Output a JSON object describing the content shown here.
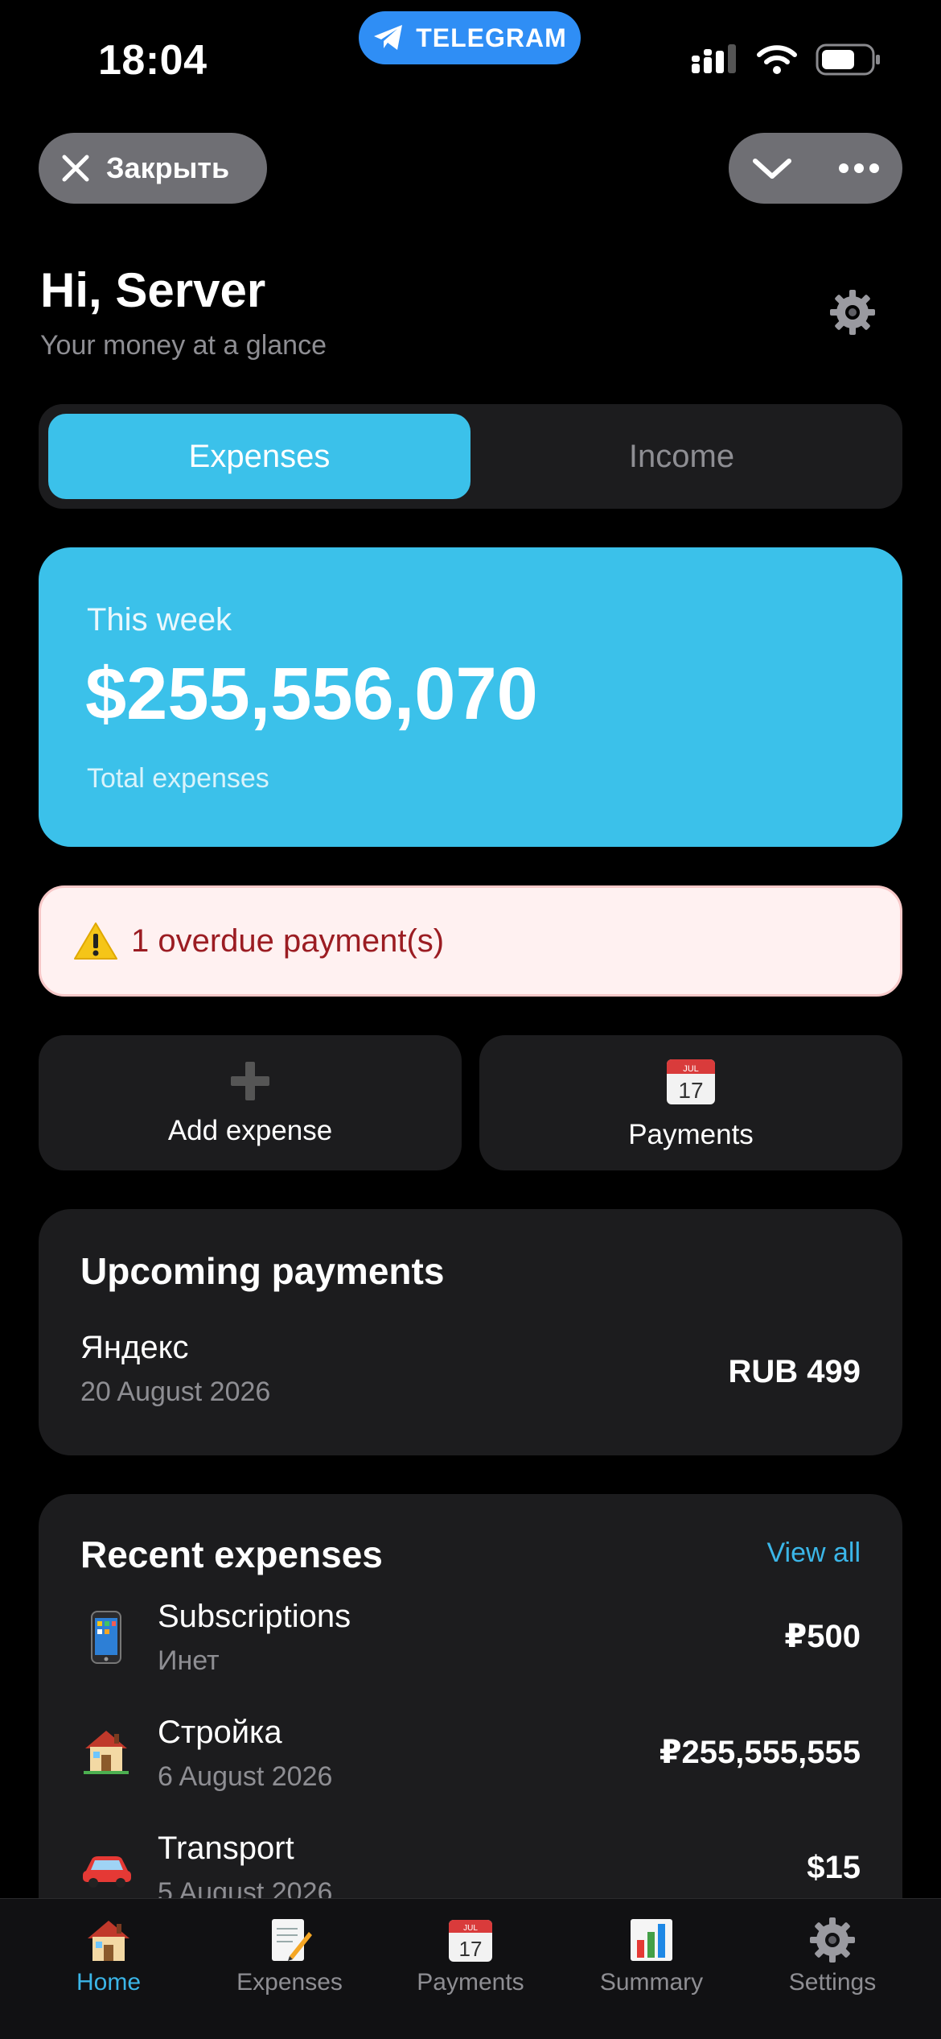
{
  "status": {
    "time": "18:04",
    "telegram_label": "TELEGRAM"
  },
  "top_controls": {
    "close_label": "Закрыть"
  },
  "header": {
    "greeting": "Hi, Server",
    "subtitle": "Your money at a glance"
  },
  "tabs": {
    "expenses": "Expenses",
    "income": "Income",
    "selected": "Expenses"
  },
  "week_card": {
    "label": "This week",
    "amount": "$255,556,070",
    "caption": "Total expenses"
  },
  "alert": {
    "text": "1 overdue payment(s)"
  },
  "quick_actions": {
    "add_expense": "Add expense",
    "payments": "Payments"
  },
  "upcoming": {
    "title": "Upcoming payments",
    "items": [
      {
        "name": "Яндекс",
        "date": "20 August 2026",
        "amount": "RUB 499"
      }
    ]
  },
  "recent": {
    "title": "Recent expenses",
    "view_all": "View all",
    "items": [
      {
        "icon": "phone-icon",
        "name": "Subscriptions",
        "sub": "Инет",
        "amount": "₽500"
      },
      {
        "icon": "house-icon",
        "name": "Стройка",
        "sub": "6 August 2026",
        "amount": "₽255,555,555"
      },
      {
        "icon": "car-icon",
        "name": "Transport",
        "sub": "5 August 2026",
        "amount": "$15"
      }
    ]
  },
  "nav": {
    "items": [
      {
        "label": "Home",
        "icon": "house-icon",
        "active": true
      },
      {
        "label": "Expenses",
        "icon": "memo-icon",
        "active": false
      },
      {
        "label": "Payments",
        "icon": "calendar-icon",
        "active": false
      },
      {
        "label": "Summary",
        "icon": "bar-chart-icon",
        "active": false
      },
      {
        "label": "Settings",
        "icon": "gear-icon",
        "active": false
      }
    ]
  },
  "colors": {
    "accent": "#3bc1ea",
    "link": "#3bb6e8",
    "alert_bg": "#fff1f1",
    "alert_text": "#9b1c22",
    "card_bg": "#1c1c1e"
  }
}
